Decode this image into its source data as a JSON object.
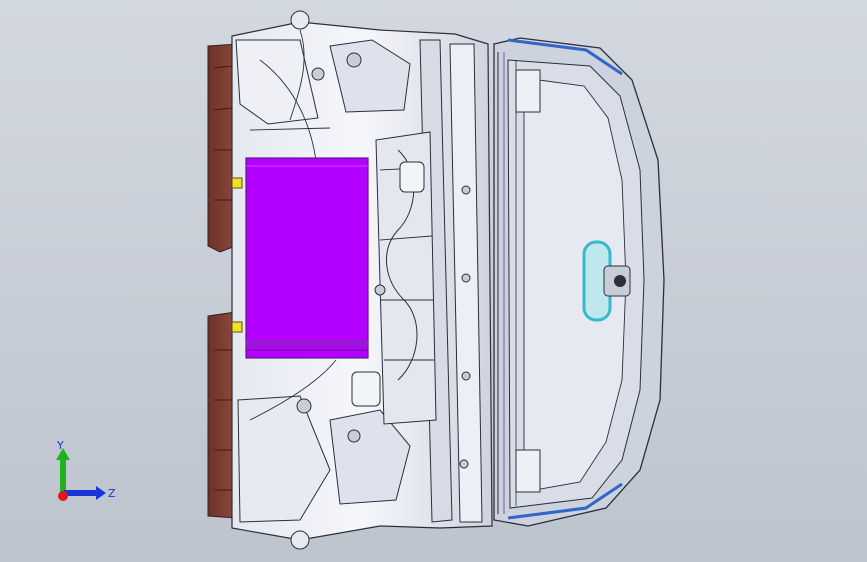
{
  "viewport": {
    "background_top": "#d3d8e0",
    "background_bottom": "#bec4ce"
  },
  "model": {
    "colors": {
      "battery": "#b400ff",
      "battery_edge": "#6a1b9a",
      "panel_light": "#f1f3f8",
      "panel_mid": "#d2d6e2",
      "edge_line": "#2b2f3a",
      "cover_brown": "#7a3d33",
      "tank_cyan": "#1ec6c0",
      "tank_orange": "#f29a1a",
      "glass_blue": "#2f66c8",
      "mirror_teal": "#36b9c9",
      "trim_yellow": "#f0e22a"
    },
    "parts": [
      "firewall-assembly",
      "battery",
      "washer-tank",
      "windshield-frame",
      "rearview-mirror",
      "cowl-covers"
    ]
  },
  "triad": {
    "y_label": "Y",
    "z_label": "Z",
    "y_color": "#1fb21f",
    "z_color": "#1a36d6",
    "x_color": "#e01818"
  }
}
